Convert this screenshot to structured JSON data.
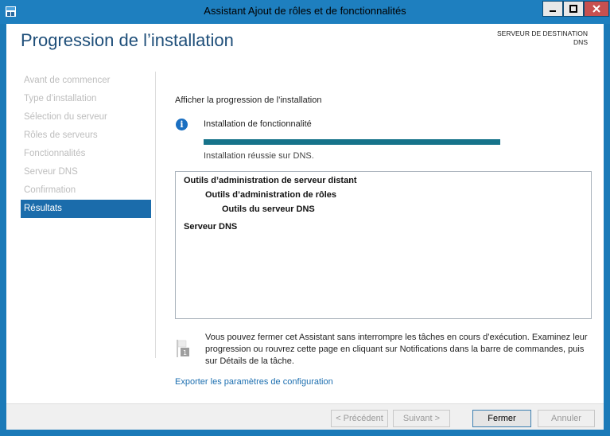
{
  "window": {
    "title": "Assistant Ajout de rôles et de fonctionnalités",
    "colors": {
      "frame": "#1e7fbf",
      "accent": "#1b6cab",
      "close": "#c75050"
    }
  },
  "header": {
    "title": "Progression de l’installation",
    "dest_label": "SERVEUR DE DESTINATION",
    "dest_value": "DNS"
  },
  "nav": {
    "items": [
      {
        "label": "Avant de commencer"
      },
      {
        "label": "Type d’installation"
      },
      {
        "label": "Sélection du serveur"
      },
      {
        "label": "Rôles de serveurs"
      },
      {
        "label": "Fonctionnalités"
      },
      {
        "label": "Serveur DNS"
      },
      {
        "label": "Confirmation"
      },
      {
        "label": "Résultats"
      }
    ],
    "active_item": "Résultats"
  },
  "main": {
    "heading": "Afficher la progression de l’installation",
    "status_title": "Installation de fonctionnalité",
    "status_icon": "info-icon",
    "progress": 1.0,
    "status_result": "Installation réussie sur DNS.",
    "results": [
      {
        "text": "Outils d’administration de serveur distant",
        "level": 0
      },
      {
        "text": "Outils d’administration de rôles",
        "level": 1
      },
      {
        "text": "Outils du serveur DNS",
        "level": 2
      },
      {
        "text": "Serveur DNS",
        "level": 0
      }
    ],
    "note": "Vous pouvez fermer cet Assistant sans interrompre les tâches en cours d’exécution. Examinez leur progression ou rouvrez cette page en cliquant sur Notifications dans la barre de commandes, puis sur Détails de la tâche.",
    "note_icon": "notification-flag-icon",
    "export_link": "Exporter les paramètres de configuration"
  },
  "footer": {
    "prev": "< Précédent",
    "next": "Suivant >",
    "close": "Fermer",
    "cancel": "Annuler"
  }
}
